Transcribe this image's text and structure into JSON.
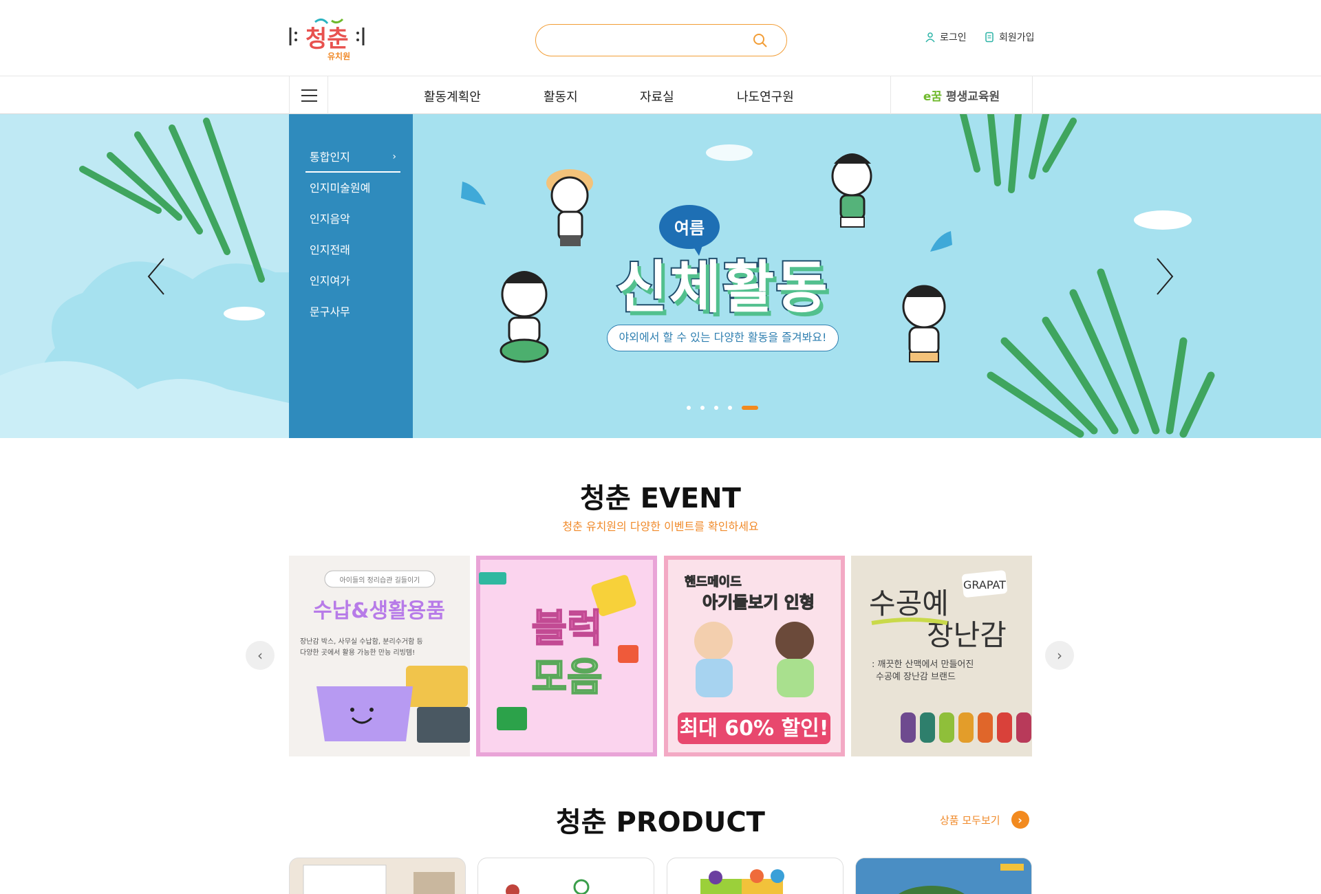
{
  "header": {
    "logo_text": "청춘",
    "logo_sub": "유치원",
    "search": {
      "placeholder": ""
    },
    "login_label": "로그인",
    "join_label": "회원가입"
  },
  "nav": {
    "items": [
      "활동계획안",
      "활동지",
      "자료실",
      "나도연구원"
    ],
    "partner_mark": "e꿈",
    "partner_name": "평생교육원"
  },
  "hero": {
    "side_menu": [
      "통합인지",
      "인지미술원예",
      "인지음악",
      "인지전래",
      "인지여가",
      "문구사무"
    ],
    "badge": "여름",
    "title": "신체활동",
    "caption": "야외에서 할 수 있는 다양한 활동을 즐겨봐요!",
    "slide_count": 5,
    "active_slide": 5
  },
  "event": {
    "title": "청춘 EVENT",
    "subtitle": "청춘 유치원의 다양한 이벤트를 확인하세요",
    "cards": [
      {
        "tag": "아이들의 정리습관 길들이기",
        "title": "수납&생활용품",
        "desc1": "장난감 박스, 사무실 수납함, 분리수거함 등",
        "desc2": "다양한 곳에서 활용 가능한 만능 리빙템!"
      },
      {
        "title1": "블럭",
        "title2": "모음"
      },
      {
        "title1": "핸드메이드",
        "title2": "아기돌보기 인형",
        "promo": "최대 60% 할인!"
      },
      {
        "title1": "수공예",
        "title2": "장난감",
        "brand": "GRAPAT",
        "desc1": ": 깨끗한 산맥에서 만들어진",
        "desc2": "수공예 장난감 브랜드"
      }
    ]
  },
  "product": {
    "title": "청춘 PRODUCT",
    "view_all": "상품 모두보기"
  },
  "colors": {
    "accent": "#f28a1f",
    "side_menu": "#2f8bbd",
    "hero_bg": "#a6e1ef"
  }
}
